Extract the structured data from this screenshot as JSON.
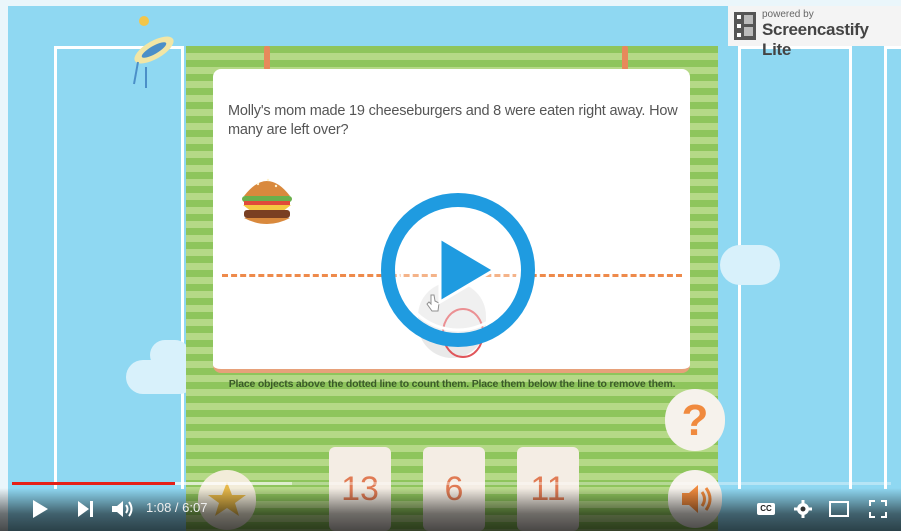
{
  "game": {
    "question": "Molly's mom made 19 cheeseburgers and 8 were eaten right away. How many are left over?",
    "instruction": "Place objects above the dotted line to count them. Place them below the line to remove them.",
    "answer_options": [
      "13",
      "6",
      "11"
    ],
    "help_label": "?"
  },
  "overlay": {
    "powered_by": "powered by",
    "brand": "Screencastify Lite"
  },
  "player": {
    "time": "1:08 / 6:07",
    "cc_label": "CC",
    "progress_fraction": 0.185
  }
}
